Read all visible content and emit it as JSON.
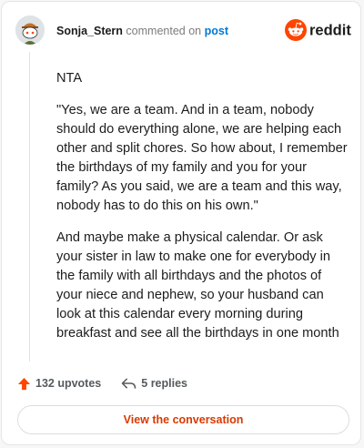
{
  "comment": {
    "username": "Sonja_Stern",
    "action_text": "commented on",
    "post_link": "post",
    "paragraphs": [
      "NTA",
      "\"Yes, we are a team. And in a team, nobody should do everything alone, we are helping each other and split chores. So how about, I remember the birthdays of my family and you for your family? As you said, we are a team and this way, nobody has to do this on his own.\"",
      "And maybe make a physical calendar. Or ask your sister in law to make one for everybody in the family with all birthdays and the photos of your niece and nephew, so your husband can look at this calendar every morning during breakfast and see all the birthdays in one month"
    ]
  },
  "brand": {
    "name": "reddit",
    "color": "#ff4500",
    "icon": "reddit-alien-icon"
  },
  "stats": {
    "upvotes": "132 upvotes",
    "upvote_icon": "upvote-arrow-icon",
    "upvote_color": "#ff4500",
    "replies": "5 replies",
    "reply_icon": "reply-arrow-icon"
  },
  "cta": {
    "label": "View the conversation",
    "color": "#d93a00"
  },
  "avatar": {
    "icon": "snoo-avatar-icon"
  }
}
